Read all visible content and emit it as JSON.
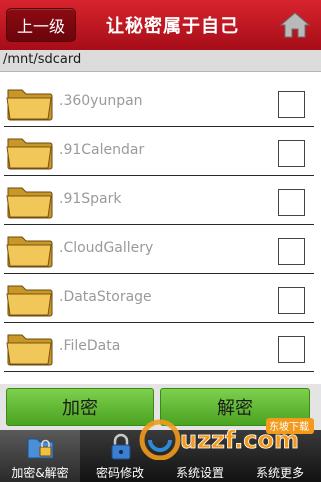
{
  "header": {
    "back_label": "上一级",
    "title": "让秘密属于自己",
    "home_icon": "home-icon"
  },
  "path": "/mnt/sdcard",
  "files": [
    {
      "name": ".360yunpan",
      "checked": false
    },
    {
      "name": ".91Calendar",
      "checked": false
    },
    {
      "name": ".91Spark",
      "checked": false
    },
    {
      "name": ".CloudGallery",
      "checked": false
    },
    {
      "name": ".DataStorage",
      "checked": false
    },
    {
      "name": ".FileData",
      "checked": false
    }
  ],
  "actions": {
    "encrypt_label": "加密",
    "decrypt_label": "解密"
  },
  "tabs": [
    {
      "label": "加密&解密",
      "icon": "folder-lock-icon",
      "active": true
    },
    {
      "label": "密码修改",
      "icon": "padlock-icon",
      "active": false
    },
    {
      "label": "系统设置",
      "icon": "settings-icon",
      "active": false
    },
    {
      "label": "系统更多",
      "icon": "more-icon",
      "active": false
    }
  ],
  "watermark": {
    "text": "uzzf.com",
    "tagline": "东坡下载"
  },
  "colors": {
    "header": "#c0141e",
    "button_green": "#5cb833",
    "tabbar": "#1e1e1e"
  }
}
